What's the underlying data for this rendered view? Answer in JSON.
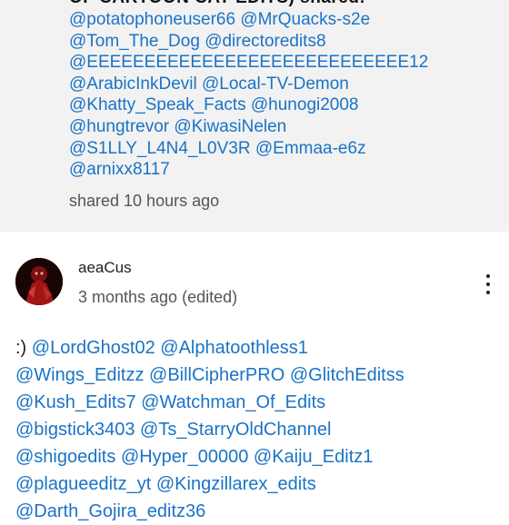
{
  "shared_card": {
    "cut_line": "OF CARTOON CAT EDITS) shared:",
    "mention_lines": [
      "@potatophoneuser66 @MrQuacks-s2e",
      "@Tom_The_Dog @directoredits8",
      "@EEEEEEEEEEEEEEEEEEEEEEEEEEEE12",
      "@ArabicInkDevil @Local-TV-Demon",
      "@Khatty_Speak_Facts @hunogi2008",
      "@hungtrevor @KiwasiNelen",
      "@S1LLY_L4N4_L0V3R @Emmaa-e6z",
      "@arnixx8117"
    ],
    "shared_time": "shared 10 hours ago"
  },
  "comment": {
    "avatar_icon": "avatar-image",
    "author": "aeaCus",
    "time": "3 months ago (edited)",
    "menu_icon": "more-vert-icon",
    "body": {
      "prefix": ":) ",
      "lines": [
        [
          "@LordGhost02",
          "@Alphatoothless1"
        ],
        [
          "@Wings_Editzz",
          "@BillCipherPRO",
          "@GlitchEditss"
        ],
        [
          "@Kush_Edits7",
          "@Watchman_Of_Edits"
        ],
        [
          "@bigstick3403",
          "@Ts_StarryOldChannel"
        ],
        [
          "@shigoedits",
          "@Hyper_00000",
          "@Kaiju_Editz1"
        ],
        [
          "@plagueeditz_yt",
          "@Kingzillarex_edits"
        ],
        [
          "@Darth_Gojira_editz36"
        ]
      ]
    }
  },
  "colors": {
    "mention": "#1a73c6",
    "card_bg": "#f2f2f2",
    "text": "#1f1f1f",
    "muted": "#555555"
  }
}
